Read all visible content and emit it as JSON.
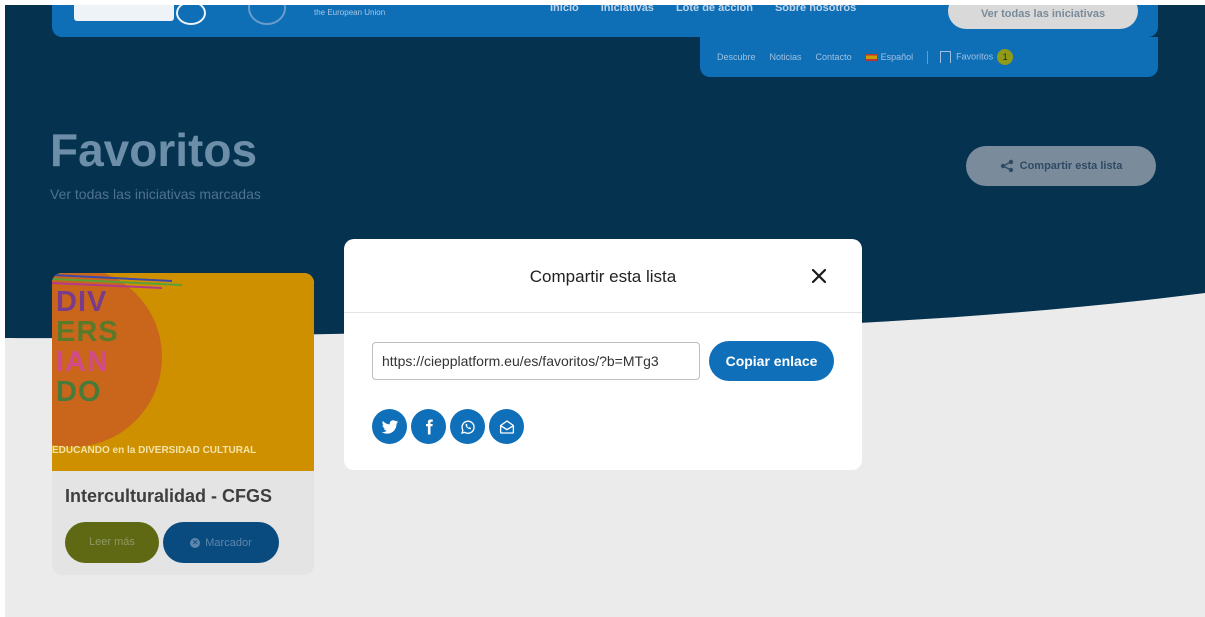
{
  "nav": {
    "eu_text": "the European Union",
    "main_items": [
      "Inicio",
      "Iniciativas",
      "Lote de acción",
      "Sobre nosotros"
    ],
    "cta": "Ver todas las iniciativas",
    "sub_items": {
      "discover": "Descubre",
      "news": "Noticias",
      "contact": "Contacto",
      "language": "Español",
      "favorites": "Favoritos",
      "favorites_count": "1"
    }
  },
  "page": {
    "title": "Favoritos",
    "subtitle": "Ver todas las iniciativas marcadas",
    "share_button": "Compartir esta lista"
  },
  "card": {
    "image_letters": [
      "DIV",
      "ERS",
      "IAN",
      "DO"
    ],
    "image_caption": "EDUCANDO en la DIVERSIDAD CULTURAL",
    "title": "Interculturalidad - CFGS",
    "read_more": "Leer más",
    "bookmark": "Marcador"
  },
  "modal": {
    "title": "Compartir esta lista",
    "link_value": "https://ciepplatform.eu/es/favoritos/?b=MTg3",
    "copy_button": "Copiar enlace",
    "social": [
      "twitter-icon",
      "facebook-icon",
      "whatsapp-icon",
      "email-icon"
    ]
  },
  "colors": {
    "primary_blue": "#0f6fb9",
    "hero_dark": "#04324f",
    "overlay_bg": "#ebebeb",
    "card_orange": "#cf9000"
  }
}
